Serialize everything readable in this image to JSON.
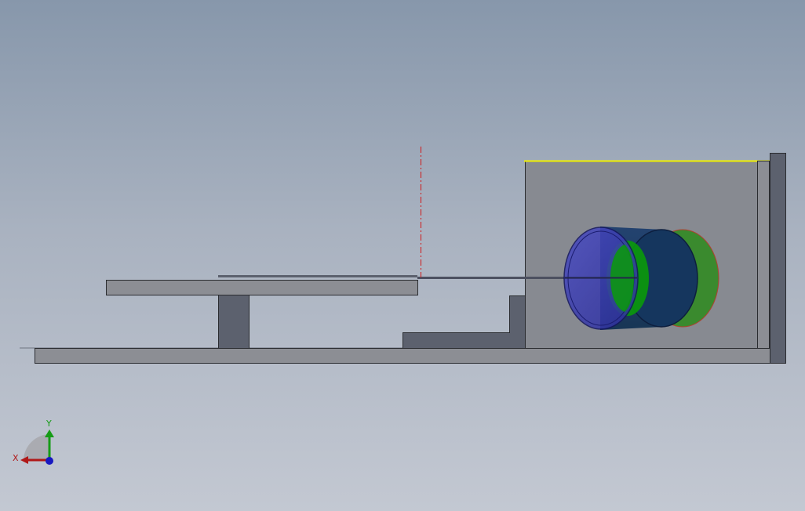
{
  "viewport": {
    "background_top": "#8797ab",
    "background_bottom": "#c3c8d2"
  },
  "model": {
    "body_color": "#5c616e",
    "plate_color": "#8c8e94",
    "wall_color": "#878a91",
    "edge_color": "#2a2c30",
    "highlight_edge_color": "#f2f200",
    "centerline_color": "#d01818",
    "cylinder_front_color": "#3d3fb0",
    "cylinder_back_color": "#3a8a2e",
    "cylinder_inner_color": "#0a9a0a"
  },
  "triad": {
    "x_label": "X",
    "y_label": "Y",
    "x_color": "#b01818",
    "y_color": "#169c16",
    "z_color": "#1818c0",
    "x_icon": "x-axis-arrow-icon",
    "y_icon": "y-axis-arrow-icon",
    "z_icon": "z-axis-dot-icon"
  }
}
